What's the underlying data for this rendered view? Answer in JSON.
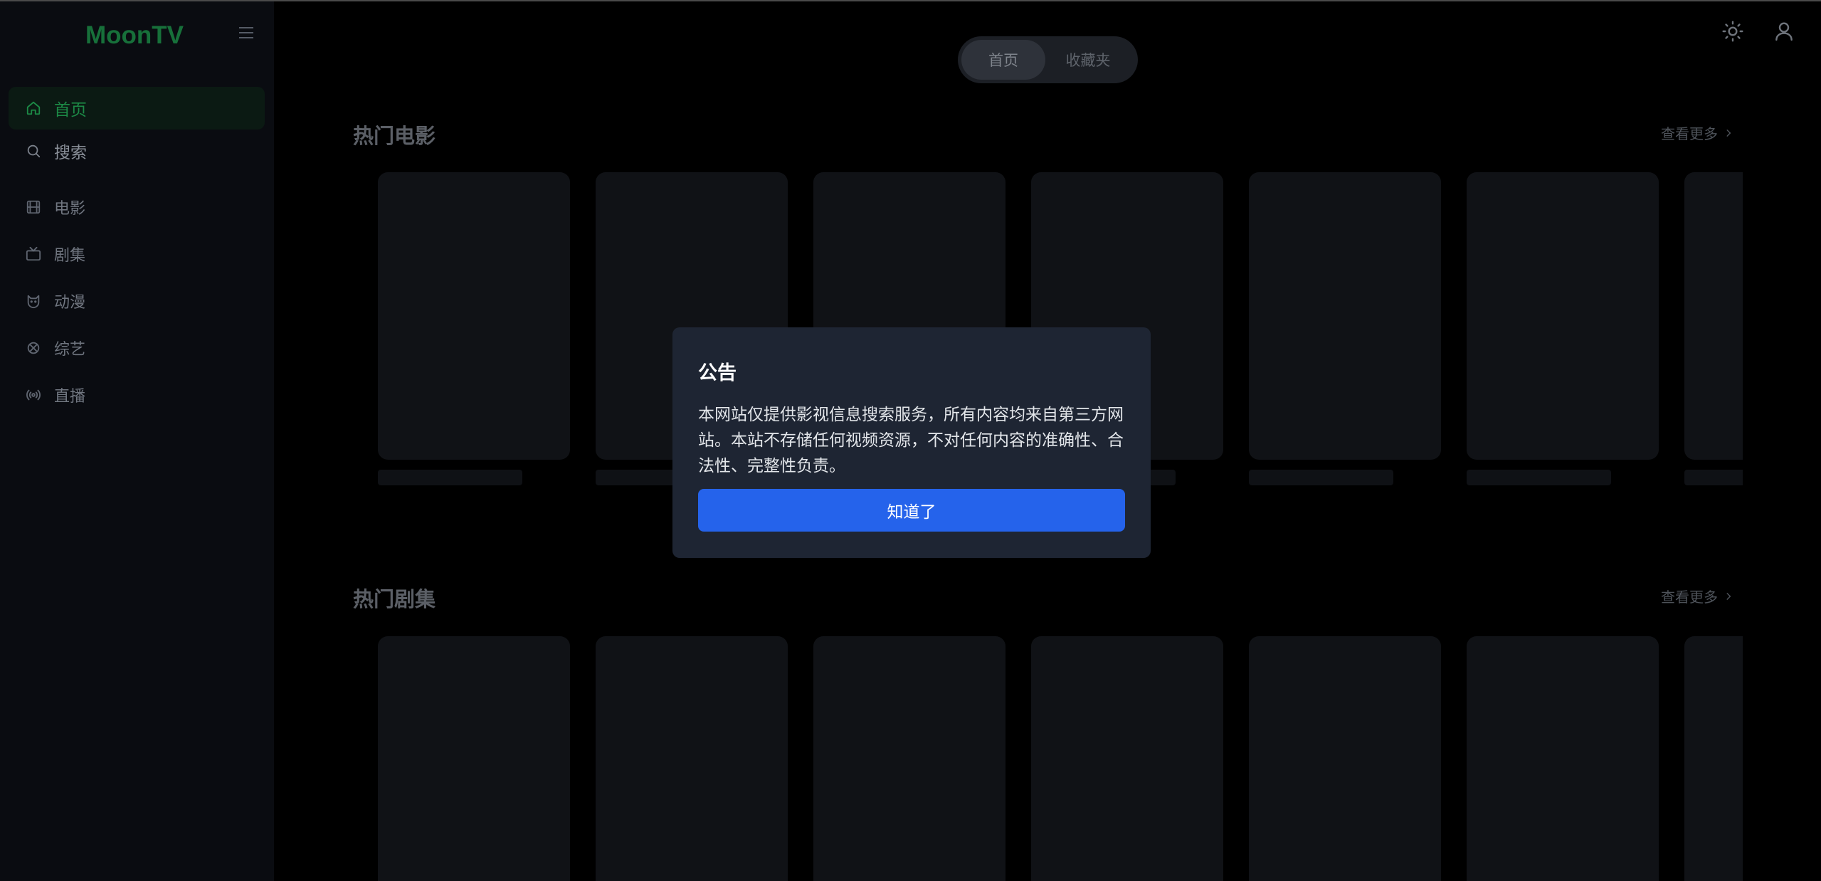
{
  "app": {
    "logo": "MoonTV"
  },
  "sidebar": {
    "items": [
      {
        "label": "首页",
        "icon": "home-icon",
        "active": true
      },
      {
        "label": "搜索",
        "icon": "search-icon"
      },
      {
        "label": "电影",
        "icon": "film-icon"
      },
      {
        "label": "剧集",
        "icon": "tv-icon"
      },
      {
        "label": "动漫",
        "icon": "cat-icon"
      },
      {
        "label": "综艺",
        "icon": "clover-icon"
      },
      {
        "label": "直播",
        "icon": "radio-icon"
      }
    ]
  },
  "topbar": {
    "tabs": [
      {
        "label": "首页",
        "active": true
      },
      {
        "label": "收藏夹"
      }
    ],
    "theme_icon": "sun-icon",
    "user_icon": "user-icon"
  },
  "sections": [
    {
      "title": "热门电影",
      "more": "查看更多"
    },
    {
      "title": "热门剧集",
      "more": "查看更多"
    }
  ],
  "modal": {
    "title": "公告",
    "body": "本网站仅提供影视信息搜索服务，所有内容均来自第三方网站。本站不存储任何视频资源，不对任何内容的准确性、合法性、完整性负责。",
    "button": "知道了"
  },
  "colors": {
    "brand": "#17703a",
    "accent": "#2563eb",
    "modal_bg": "#1e2533"
  }
}
